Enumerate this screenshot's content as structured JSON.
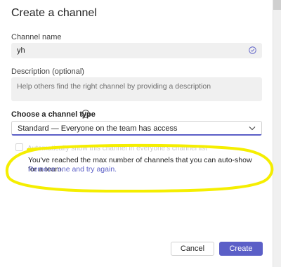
{
  "dialog": {
    "title": "Create a channel",
    "channel_name": {
      "label": "Channel name",
      "value": "yh"
    },
    "description": {
      "label": "Description (optional)",
      "placeholder": "Help others find the right channel by providing a description"
    },
    "channel_type": {
      "label": "Choose a channel type",
      "selected": "Standard — Everyone on the team has access"
    },
    "autoshow": {
      "label": "Automatically show this channel in everyone's channel list",
      "checked": false,
      "disabled": true
    },
    "warning": {
      "message": "You've reached the max number of channels that you can auto-show for a team.",
      "link": "Remove one and try again."
    },
    "buttons": {
      "cancel": "Cancel",
      "create": "Create"
    }
  },
  "colors": {
    "accent": "#5b5fc7",
    "highlight": "#f5ee00",
    "field_bg": "#f0f0f0"
  },
  "icons": [
    "check-circle-icon",
    "info-icon",
    "chevron-down-icon"
  ]
}
